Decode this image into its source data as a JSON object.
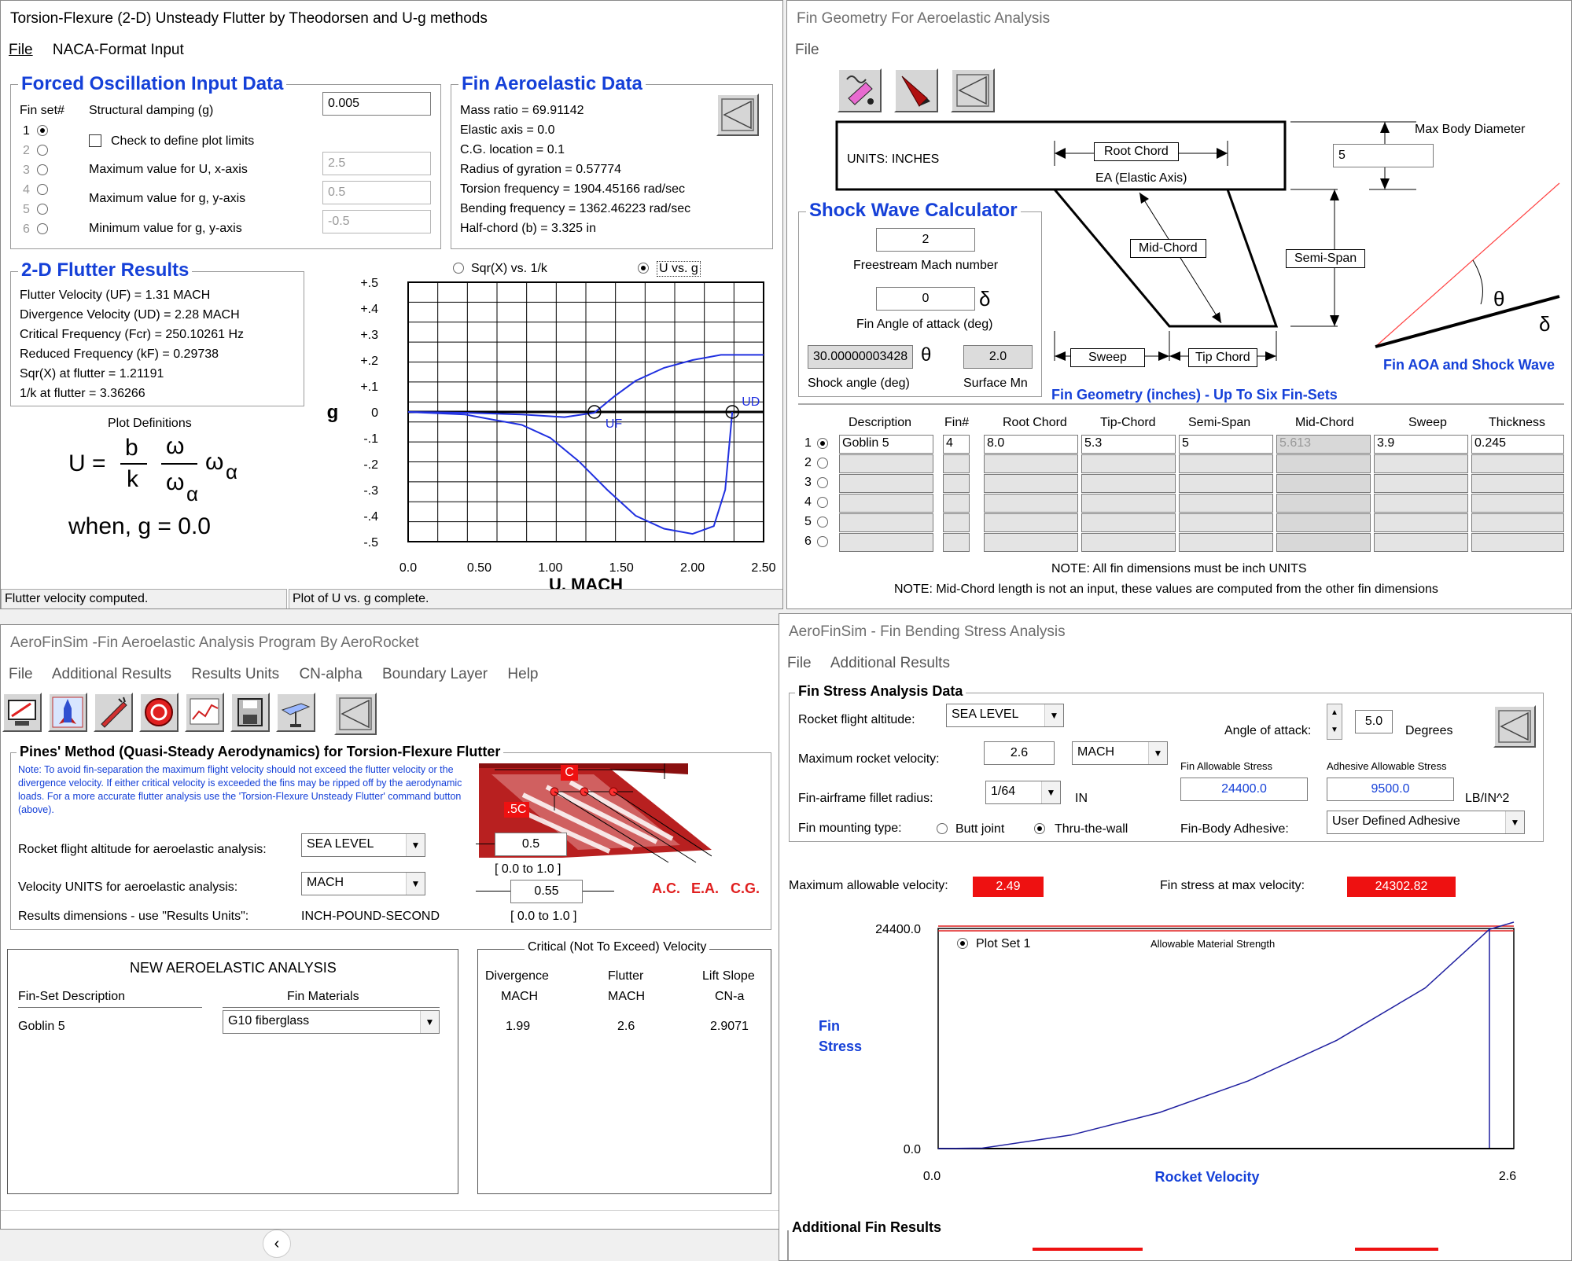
{
  "w1": {
    "title": "Torsion-Flexure (2-D) Unsteady Flutter by Theodorsen and U-g methods",
    "menu": [
      "File",
      "NACA-Format Input"
    ],
    "forced": {
      "title": "Forced Oscillation Input Data",
      "finset_label": "Fin set#",
      "finsets": [
        "1",
        "2",
        "3",
        "4",
        "5",
        "6"
      ],
      "damping_label": "Structural damping (g)",
      "damping_value": "0.005",
      "check_label": "Check to define plot limits",
      "max_u_label": "Maximum value for U, x-axis",
      "max_u_value": "2.5",
      "max_g_label": "Maximum value for g, y-axis",
      "max_g_value": "0.5",
      "min_g_label": "Minimum value for g, y-axis",
      "min_g_value": "-0.5"
    },
    "aero": {
      "title": "Fin Aeroelastic Data",
      "lines": [
        "Mass ratio = 69.91142",
        "Elastic axis = 0.0",
        "C.G. location = 0.1",
        "Radius of gyration = 0.57774",
        "Torsion frequency = 1904.45166 rad/sec",
        "Bending frequency = 1362.46223 rad/sec",
        "Half-chord (b) = 3.325 in"
      ]
    },
    "results": {
      "title": "2-D Flutter Results",
      "lines": [
        "Flutter Velocity (UF) = 1.31 MACH",
        "Divergence Velocity (UD) = 2.28 MACH",
        "Critical Frequency (Fcr) = 250.10261 Hz",
        "Reduced Frequency (kF) = 0.29738",
        "Sqr(X) at flutter = 1.21191",
        "1/k at flutter = 3.36266"
      ]
    },
    "plotdef": {
      "title": "Plot Definitions",
      "u": "U =",
      "b": "b",
      "k": "k",
      "omega": "ω",
      "omega_alpha": "ω",
      "alpha": "α",
      "when": "when,  g = 0.0"
    },
    "radio_sqr": "Sqr(X) vs. 1/k",
    "radio_ug": "U vs. g",
    "status_left": "Flutter velocity computed.",
    "status_right": "Plot of U vs. g complete.",
    "chart_data": {
      "type": "line",
      "xlabel": "U, MACH",
      "ylabel": "g",
      "xlim": [
        0,
        2.5
      ],
      "ylim": [
        -0.5,
        0.5
      ],
      "x_ticks": [
        "0.0",
        "0.50",
        "1.00",
        "1.50",
        "2.00",
        "2.50"
      ],
      "y_ticks": [
        "+.5",
        "+.4",
        "+.3",
        "+.2",
        "+.1",
        "0",
        "-.1",
        "-.2",
        "-.3",
        "-.4",
        "-.5"
      ],
      "annotations": [
        "UF",
        "UD"
      ],
      "series": [
        {
          "x": [
            0,
            0.4,
            0.8,
            1.1,
            1.31,
            1.45,
            1.6,
            1.8,
            2.0,
            2.2,
            2.5
          ],
          "y": [
            0,
            -0.003,
            -0.01,
            -0.02,
            -0.003,
            0.06,
            0.12,
            0.17,
            0.2,
            0.22,
            0.22
          ]
        },
        {
          "x": [
            0,
            0.4,
            0.8,
            1.0,
            1.2,
            1.4,
            1.6,
            1.8,
            2.0,
            2.15,
            2.23,
            2.26,
            2.28
          ],
          "y": [
            0,
            -0.01,
            -0.05,
            -0.1,
            -0.19,
            -0.3,
            -0.4,
            -0.45,
            -0.47,
            -0.44,
            -0.3,
            -0.12,
            0
          ]
        }
      ],
      "grid": true,
      "colors": {
        "line": "#2030e0"
      }
    }
  },
  "w2": {
    "title": "Fin Geometry For Aeroelastic Analysis",
    "menu": [
      "File"
    ],
    "units": "UNITS:  INCHES",
    "root_chord": "Root Chord",
    "ea": "EA (Elastic Axis)",
    "max_body_label": "Max Body Diameter",
    "max_body_value": "5",
    "mid_chord": "Mid-Chord",
    "semi_span": "Semi-Span",
    "sweep": "Sweep",
    "tip_chord": "Tip Chord",
    "shock": {
      "title": "Shock Wave Calculator",
      "mach_value": "2",
      "mach_label": "Freestream Mach number",
      "aoa_value": "0",
      "delta": "δ",
      "aoa_label": "Fin Angle of attack (deg)",
      "shock_angle_value": "30.00000003428",
      "theta": "θ",
      "surface_mn_value": "2.0",
      "shock_angle_label": "Shock angle (deg)",
      "surface_mn_label": "Surface Mn"
    },
    "fin_aoa_label": "Fin AOA and Shock Wave",
    "geom_caption": "Fin Geometry (inches) - Up To Six Fin-Sets",
    "table_headers": [
      "Description",
      "Fin#",
      "Root Chord",
      "Tip-Chord",
      "Semi-Span",
      "Mid-Chord",
      "Sweep",
      "Thickness"
    ],
    "table_row1": [
      "Goblin 5",
      "4",
      "8.0",
      "5.3",
      "5",
      "5.613",
      "3.9",
      "0.245"
    ],
    "rows": [
      "1",
      "2",
      "3",
      "4",
      "5",
      "6"
    ],
    "note1": "NOTE: All fin dimensions must be inch UNITS",
    "note2": "NOTE: Mid-Chord length is not an input, these values are computed from the other fin dimensions"
  },
  "w3": {
    "title": "AeroFinSim -Fin Aeroelastic Analysis Program By AeroRocket",
    "menu": [
      "File",
      "Additional Results",
      "Results Units",
      "CN-alpha",
      "Boundary Layer",
      "Help"
    ],
    "pines_title": "Pines' Method (Quasi-Steady Aerodynamics) for Torsion-Flexure Flutter",
    "note": "Note: To avoid fin-separation the maximum flight velocity should not exceed the flutter velocity or the divergence velocity. If either critical velocity is exceeded the fins may be ripped off by the aerodynamic loads. For a more accurate flutter analysis use the 'Torsion-Flexure Unsteady Flutter' command button (above).",
    "alt_label": "Rocket flight altitude for aeroelastic analysis:",
    "alt_value": "SEA LEVEL",
    "vel_label": "Velocity UNITS for aeroelastic analysis:",
    "vel_value": "MACH",
    "dims_label": "Results dimensions - use \"Results Units\":",
    "dims_value": "INCH-POUND-SECOND",
    "c_label": "C",
    "fc_label": ".5C",
    "ac_value": "0.5",
    "range1": "[ 0.0 to 1.0 ]",
    "cg_value": "0.55",
    "range2": "[ 0.0 to 1.0 ]",
    "ac": "A.C.",
    "ea": "E.A.",
    "cg": "C.G.",
    "new_title": "NEW AEROELASTIC ANALYSIS",
    "finset_desc_label": "Fin-Set Description",
    "fin_mat_label": "Fin Materials",
    "finset_desc": "Goblin 5",
    "fin_mat": "G10 fiberglass",
    "crit_title": "Critical (Not To Exceed) Velocity",
    "crit_headers": [
      "Divergence",
      "Flutter",
      "Lift Slope"
    ],
    "crit_sub": [
      "MACH",
      "MACH",
      "CN-a"
    ],
    "crit_values": [
      "1.99",
      "2.6",
      "2.9071"
    ]
  },
  "w4": {
    "title": "AeroFinSim - Fin Bending Stress Analysis",
    "menu": [
      "File",
      "Additional Results"
    ],
    "group_title": "Fin Stress Analysis Data",
    "alt_label": "Rocket flight altitude:",
    "alt_value": "SEA LEVEL",
    "aoa_label": "Angle of attack:",
    "aoa_value": "5.0",
    "aoa_unit": "Degrees",
    "maxvel_label": "Maximum rocket velocity:",
    "maxvel_value": "2.6",
    "maxvel_unit": "MACH",
    "fas_label": "Fin Allowable Stress",
    "aas_label": "Adhesive Allowable Stress",
    "fillet_label": "Fin-airframe fillet radius:",
    "fillet_value": "1/64",
    "fillet_unit": "IN",
    "fas_value": "24400.0",
    "aas_value": "9500.0",
    "stress_unit": "LB/IN^2",
    "mount_label": "Fin mounting type:",
    "butt": "Butt joint",
    "thru": "Thru-the-wall",
    "adhesive_label": "Fin-Body Adhesive:",
    "adhesive_value": "User Defined Adhesive",
    "maxallow_label": "Maximum allowable velocity:",
    "maxallow_value": "2.49",
    "finstress_label": "Fin stress at max velocity:",
    "finstress_value": "24302.82",
    "add_results": "Additional Fin Results",
    "chart_data": {
      "type": "line",
      "xlabel": "Rocket Velocity",
      "ylabel": "Fin Stress",
      "legend": "Plot Set 1",
      "annotation": "Allowable Material Strength",
      "x_ticks": [
        "0.0",
        "2.6"
      ],
      "y_ticks": [
        "24400.0",
        "0.0"
      ],
      "xlim": [
        0,
        2.6
      ],
      "ylim": [
        0,
        24400
      ],
      "allowable": 24400,
      "vertical_at": 2.49,
      "series": [
        {
          "x": [
            0,
            0.2,
            0.6,
            1.0,
            1.4,
            1.8,
            2.2,
            2.49,
            2.6
          ],
          "y": [
            0,
            50,
            1500,
            4000,
            7500,
            12000,
            17800,
            24300,
            26000
          ]
        }
      ],
      "colors": {
        "line": "#2020a0",
        "allowable": "#e02020"
      }
    }
  }
}
